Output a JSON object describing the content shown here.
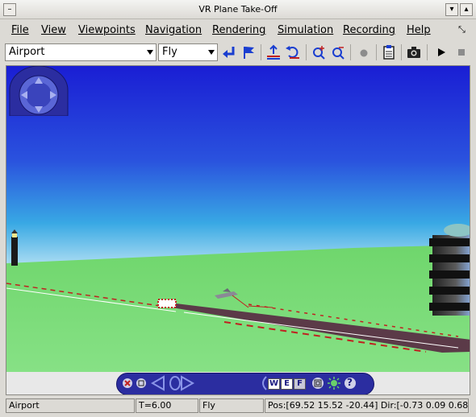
{
  "window": {
    "title": "VR Plane Take-Off"
  },
  "menubar": {
    "items": [
      "File",
      "View",
      "Viewpoints",
      "Navigation",
      "Rendering",
      "Simulation",
      "Recording",
      "Help"
    ]
  },
  "toolbar": {
    "viewpoint_select": "Airport",
    "navmode_select": "Fly",
    "icons": [
      "return-arrow-icon",
      "flag-icon",
      "straighten-up-icon",
      "undo-move-icon",
      "zoom-in-icon",
      "zoom-out-icon",
      "record-dot-icon",
      "clipboard-icon",
      "camera-icon",
      "play-icon",
      "stop-icon"
    ]
  },
  "nav_panel": {
    "w_label": "W",
    "e_label": "E",
    "f_label": "F",
    "help_label": "?"
  },
  "status": {
    "viewpoint": "Airport",
    "time": "T=6.00",
    "mode": "Fly",
    "position": "Pos:[69.52 15.52 -20.44] Dir:[-0.73 0.09 0.68]"
  },
  "colors": {
    "sky_top": "#1a1ed4",
    "sky_bottom": "#c8eaf6",
    "ground": "#6fd66c",
    "runway": "#5b3a48",
    "dock": "#2b2da0"
  }
}
